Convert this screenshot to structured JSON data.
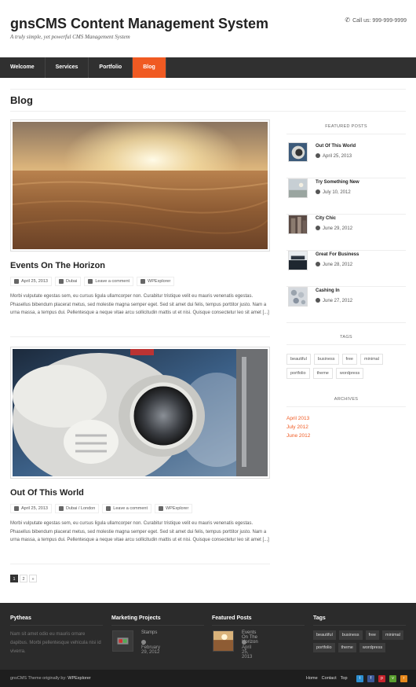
{
  "header": {
    "title": "gnsCMS Content Management System",
    "tagline": "A truly simple, yet powerful CMS Management System",
    "call": "Call us: 999-999-9999"
  },
  "nav": {
    "items": [
      "Welcome",
      "Services",
      "Portfolio",
      "Blog"
    ],
    "active": "Blog",
    "accent": "#f05a22"
  },
  "page": {
    "title": "Blog"
  },
  "posts": [
    {
      "title": "Events On The Horizon",
      "date": "April 25, 2013",
      "category": "Dubai",
      "comments": "Leave a comment",
      "author": "WPExplorer",
      "excerpt": "Morbi vulputate egestas sem, eu cursus ligula ullamcorper non. Curabitur tristique velit eu mauris venenatis egestas. Phasellus bibendum placerat metus, sed molestie magna semper eget. Sed sit amet dui felis, tempus porttitor justo. Nam a urna massa, a tempus dui. Pellentesque a neque vitae arcu sollicitudin mattis ut et nisi. Quisque consectetur leo sit amet [...]"
    },
    {
      "title": "Out Of This World",
      "date": "April 25, 2013",
      "category": "Dubai / London",
      "comments": "Leave a comment",
      "author": "WPExplorer",
      "excerpt": "Morbi vulputate egestas sem, eu cursus ligula ullamcorper non. Curabitur tristique velit eu mauris venenatis egestas. Phasellus bibendum placerat metus, sed molestie magna semper eget. Sed sit amet dui felis, tempus porttitor justo. Nam a urna massa, a tempus dui. Pellentesque a neque vitae arcu sollicitudin mattis ut et nisi. Quisque consectetur leo sit amet [...]"
    }
  ],
  "pagination": [
    "1",
    "2",
    "»"
  ],
  "sidebar": {
    "featured_heading": "Featured Posts",
    "featured": [
      {
        "title": "Out Of This World",
        "date": "April 25, 2013"
      },
      {
        "title": "Try Something New",
        "date": "July 10, 2012"
      },
      {
        "title": "City Chic",
        "date": "June 29, 2012"
      },
      {
        "title": "Great For Business",
        "date": "June 28, 2012"
      },
      {
        "title": "Cashing In",
        "date": "June 27, 2012"
      }
    ],
    "tags_heading": "Tags",
    "tags": [
      "beautiful",
      "business",
      "free",
      "minimal",
      "portfolio",
      "theme",
      "wordpress"
    ],
    "archives_heading": "Archives",
    "archives": [
      "April 2013",
      "July 2012",
      "June 2012"
    ]
  },
  "footer": {
    "col1": {
      "heading": "Pytheas",
      "text": "Nam sit amet odio eu mauris ornare dapibus. Morbi pellentesque vehicula nisi id viverra."
    },
    "col2": {
      "heading": "Marketing Projects",
      "item_title": "Stamps",
      "item_date": "February 29, 2012"
    },
    "col3": {
      "heading": "Featured Posts",
      "item_title": "Events On The Horizon",
      "item_date": "April 25, 2013"
    },
    "col4": {
      "heading": "Tags",
      "tags": [
        "beautiful",
        "business",
        "free",
        "minimal",
        "portfolio",
        "theme",
        "wordpress"
      ]
    },
    "copyright_prefix": "gnsCMS Theme originally by:",
    "copyright_link": "WPExplorer",
    "links": [
      "Home",
      "Contact",
      "Top"
    ],
    "social_icons": [
      "twitter-icon",
      "facebook-icon",
      "pinterest-icon",
      "vimeo-icon",
      "rss-icon"
    ]
  }
}
